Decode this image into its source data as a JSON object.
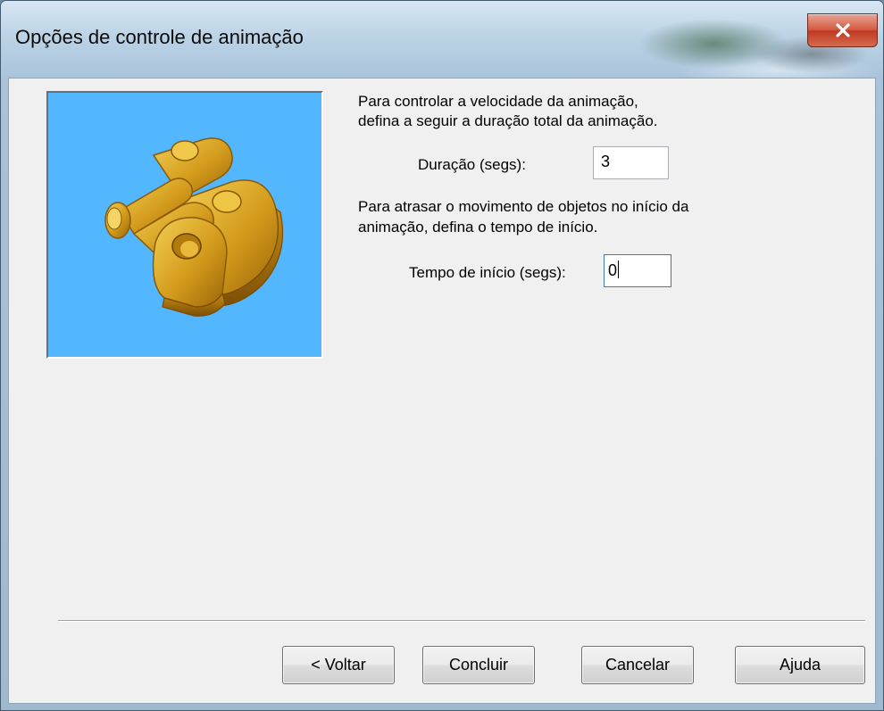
{
  "window": {
    "title": "Opções de controle de animação",
    "accent": "#c8432a"
  },
  "preview": {
    "background": "#52b7ff",
    "image_subject": "gold-mechanical-bracket-part"
  },
  "content": {
    "duration_intro": "Para controlar a velocidade da animação,\ndefina a seguir a duração total da animação.",
    "duration_intro_line1": "Para controlar a velocidade da animação,",
    "duration_intro_line2": "defina a seguir a duração total da animação.",
    "duration_label": "Duração (segs):",
    "duration_value": "3",
    "start_intro_line1": "Para atrasar o movimento de objetos no início da",
    "start_intro_line2": "animação, defina o tempo de início.",
    "start_label": "Tempo de início (segs):",
    "start_value": "0"
  },
  "buttons": {
    "back": "< Voltar",
    "finish": "Concluir",
    "cancel": "Cancelar",
    "help": "Ajuda"
  },
  "icons": {
    "close": "close-icon"
  }
}
